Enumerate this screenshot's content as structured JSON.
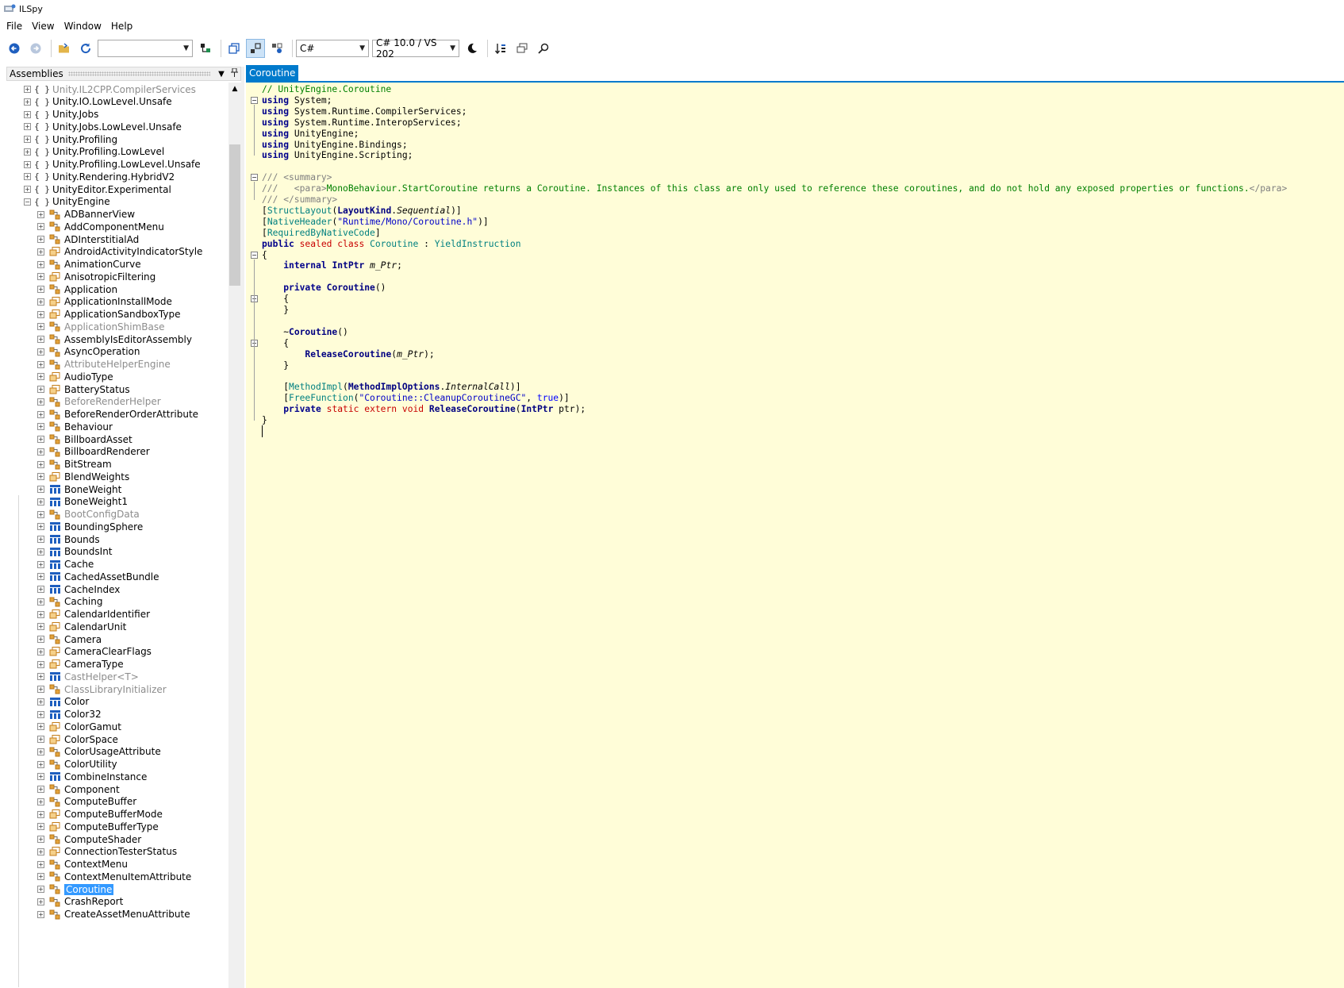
{
  "window": {
    "title": "ILSpy"
  },
  "menu": [
    "File",
    "View",
    "Window",
    "Help"
  ],
  "toolbar": {
    "search_combo": "",
    "language": "C#",
    "language_version": "C# 10.0 / VS 202"
  },
  "left_pane": {
    "header": "Assemblies"
  },
  "tree": [
    {
      "label": "Unity.IL2CPP.CompilerServices",
      "icon": "namespace",
      "level": 0,
      "dim": true
    },
    {
      "label": "Unity.IO.LowLevel.Unsafe",
      "icon": "namespace",
      "level": 0
    },
    {
      "label": "Unity.Jobs",
      "icon": "namespace",
      "level": 0
    },
    {
      "label": "Unity.Jobs.LowLevel.Unsafe",
      "icon": "namespace",
      "level": 0
    },
    {
      "label": "Unity.Profiling",
      "icon": "namespace",
      "level": 0
    },
    {
      "label": "Unity.Profiling.LowLevel",
      "icon": "namespace",
      "level": 0
    },
    {
      "label": "Unity.Profiling.LowLevel.Unsafe",
      "icon": "namespace",
      "level": 0
    },
    {
      "label": "Unity.Rendering.HybridV2",
      "icon": "namespace",
      "level": 0
    },
    {
      "label": "UnityEditor.Experimental",
      "icon": "namespace",
      "level": 0
    },
    {
      "label": "UnityEngine",
      "icon": "namespace",
      "level": 0,
      "expanded": true
    },
    {
      "label": "ADBannerView",
      "icon": "class",
      "level": 1
    },
    {
      "label": "AddComponentMenu",
      "icon": "class",
      "level": 1
    },
    {
      "label": "ADInterstitialAd",
      "icon": "class",
      "level": 1
    },
    {
      "label": "AndroidActivityIndicatorStyle",
      "icon": "enum",
      "level": 1
    },
    {
      "label": "AnimationCurve",
      "icon": "class",
      "level": 1
    },
    {
      "label": "AnisotropicFiltering",
      "icon": "enum",
      "level": 1
    },
    {
      "label": "Application",
      "icon": "class",
      "level": 1
    },
    {
      "label": "ApplicationInstallMode",
      "icon": "enum",
      "level": 1
    },
    {
      "label": "ApplicationSandboxType",
      "icon": "enum",
      "level": 1
    },
    {
      "label": "ApplicationShimBase",
      "icon": "class",
      "level": 1,
      "dim": true
    },
    {
      "label": "AssemblyIsEditorAssembly",
      "icon": "class",
      "level": 1
    },
    {
      "label": "AsyncOperation",
      "icon": "class",
      "level": 1
    },
    {
      "label": "AttributeHelperEngine",
      "icon": "class",
      "level": 1,
      "dim": true
    },
    {
      "label": "AudioType",
      "icon": "enum",
      "level": 1
    },
    {
      "label": "BatteryStatus",
      "icon": "enum",
      "level": 1
    },
    {
      "label": "BeforeRenderHelper",
      "icon": "class-internal",
      "level": 1,
      "dim": true
    },
    {
      "label": "BeforeRenderOrderAttribute",
      "icon": "class",
      "level": 1
    },
    {
      "label": "Behaviour",
      "icon": "class",
      "level": 1
    },
    {
      "label": "BillboardAsset",
      "icon": "class",
      "level": 1
    },
    {
      "label": "BillboardRenderer",
      "icon": "class",
      "level": 1
    },
    {
      "label": "BitStream",
      "icon": "class",
      "level": 1
    },
    {
      "label": "BlendWeights",
      "icon": "enum",
      "level": 1
    },
    {
      "label": "BoneWeight",
      "icon": "struct",
      "level": 1
    },
    {
      "label": "BoneWeight1",
      "icon": "struct",
      "level": 1
    },
    {
      "label": "BootConfigData",
      "icon": "class",
      "level": 1,
      "dim": true
    },
    {
      "label": "BoundingSphere",
      "icon": "struct",
      "level": 1
    },
    {
      "label": "Bounds",
      "icon": "struct",
      "level": 1
    },
    {
      "label": "BoundsInt",
      "icon": "struct",
      "level": 1
    },
    {
      "label": "Cache",
      "icon": "struct",
      "level": 1
    },
    {
      "label": "CachedAssetBundle",
      "icon": "struct",
      "level": 1
    },
    {
      "label": "CacheIndex",
      "icon": "struct",
      "level": 1
    },
    {
      "label": "Caching",
      "icon": "class",
      "level": 1
    },
    {
      "label": "CalendarIdentifier",
      "icon": "enum",
      "level": 1
    },
    {
      "label": "CalendarUnit",
      "icon": "enum",
      "level": 1
    },
    {
      "label": "Camera",
      "icon": "class",
      "level": 1
    },
    {
      "label": "CameraClearFlags",
      "icon": "enum",
      "level": 1
    },
    {
      "label": "CameraType",
      "icon": "enum",
      "level": 1
    },
    {
      "label": "CastHelper<T>",
      "icon": "struct-internal",
      "level": 1,
      "dim": true
    },
    {
      "label": "ClassLibraryInitializer",
      "icon": "class-internal",
      "level": 1,
      "dim": true
    },
    {
      "label": "Color",
      "icon": "struct",
      "level": 1
    },
    {
      "label": "Color32",
      "icon": "struct",
      "level": 1
    },
    {
      "label": "ColorGamut",
      "icon": "enum",
      "level": 1
    },
    {
      "label": "ColorSpace",
      "icon": "enum",
      "level": 1
    },
    {
      "label": "ColorUsageAttribute",
      "icon": "class",
      "level": 1
    },
    {
      "label": "ColorUtility",
      "icon": "class",
      "level": 1
    },
    {
      "label": "CombineInstance",
      "icon": "struct",
      "level": 1
    },
    {
      "label": "Component",
      "icon": "class",
      "level": 1
    },
    {
      "label": "ComputeBuffer",
      "icon": "class",
      "level": 1
    },
    {
      "label": "ComputeBufferMode",
      "icon": "enum",
      "level": 1
    },
    {
      "label": "ComputeBufferType",
      "icon": "enum",
      "level": 1
    },
    {
      "label": "ComputeShader",
      "icon": "class",
      "level": 1
    },
    {
      "label": "ConnectionTesterStatus",
      "icon": "enum",
      "level": 1
    },
    {
      "label": "ContextMenu",
      "icon": "class",
      "level": 1
    },
    {
      "label": "ContextMenuItemAttribute",
      "icon": "class",
      "level": 1
    },
    {
      "label": "Coroutine",
      "icon": "class",
      "level": 1,
      "selected": true
    },
    {
      "label": "CrashReport",
      "icon": "class",
      "level": 1
    },
    {
      "label": "CreateAssetMenuAttribute",
      "icon": "class",
      "level": 1
    }
  ],
  "document": {
    "tab": "Coroutine",
    "code": [
      [
        [
          "c",
          "// UnityEngine.Coroutine"
        ]
      ],
      [
        [
          "k",
          "using"
        ],
        [
          "",
          " System;"
        ]
      ],
      [
        [
          "k",
          "using"
        ],
        [
          "",
          " System.Runtime.CompilerServices;"
        ]
      ],
      [
        [
          "k",
          "using"
        ],
        [
          "",
          " System.Runtime.InteropServices;"
        ]
      ],
      [
        [
          "k",
          "using"
        ],
        [
          "",
          " UnityEngine;"
        ]
      ],
      [
        [
          "k",
          "using"
        ],
        [
          "",
          " UnityEngine.Bindings;"
        ]
      ],
      [
        [
          "k",
          "using"
        ],
        [
          "",
          " UnityEngine.Scripting;"
        ]
      ],
      [],
      [
        [
          "cg",
          "/// <summary>"
        ]
      ],
      [
        [
          "cg",
          "///   <para>"
        ],
        [
          "c",
          "MonoBehaviour.StartCoroutine returns a Coroutine. Instances of this class are only used to reference these coroutines, and do not hold any exposed properties or functions."
        ],
        [
          "cg",
          "</para>"
        ]
      ],
      [
        [
          "cg",
          "/// </summary>"
        ]
      ],
      [
        [
          "",
          "["
        ],
        [
          "t",
          "StructLayout"
        ],
        [
          "",
          "("
        ],
        [
          "m",
          "LayoutKind"
        ],
        [
          "",
          "."
        ],
        [
          "i",
          "Sequential"
        ],
        [
          "",
          ")]"
        ]
      ],
      [
        [
          "",
          "["
        ],
        [
          "t",
          "NativeHeader"
        ],
        [
          "",
          "("
        ],
        [
          "s",
          "\"Runtime/Mono/Coroutine.h\""
        ],
        [
          "",
          ")]"
        ]
      ],
      [
        [
          "",
          "["
        ],
        [
          "t",
          "RequiredByNativeCode"
        ],
        [
          "",
          "]"
        ]
      ],
      [
        [
          "k",
          "public"
        ],
        [
          "",
          " "
        ],
        [
          "kr",
          "sealed"
        ],
        [
          "",
          " "
        ],
        [
          "kr",
          "class"
        ],
        [
          "",
          " "
        ],
        [
          "t",
          "Coroutine"
        ],
        [
          "",
          " : "
        ],
        [
          "t",
          "YieldInstruction"
        ]
      ],
      [
        [
          "",
          "{"
        ]
      ],
      [
        [
          "",
          "    "
        ],
        [
          "k",
          "internal"
        ],
        [
          "",
          " "
        ],
        [
          "m",
          "IntPtr"
        ],
        [
          "",
          " "
        ],
        [
          "i",
          "m_Ptr"
        ],
        [
          "",
          ";"
        ]
      ],
      [],
      [
        [
          "",
          "    "
        ],
        [
          "k",
          "private"
        ],
        [
          "",
          " "
        ],
        [
          "m",
          "Coroutine"
        ],
        [
          "",
          "()"
        ]
      ],
      [
        [
          "",
          "    {"
        ]
      ],
      [
        [
          "",
          "    }"
        ]
      ],
      [],
      [
        [
          "",
          "    ~"
        ],
        [
          "m",
          "Coroutine"
        ],
        [
          "",
          "()"
        ]
      ],
      [
        [
          "",
          "    {"
        ]
      ],
      [
        [
          "",
          "        "
        ],
        [
          "m",
          "ReleaseCoroutine"
        ],
        [
          "",
          "("
        ],
        [
          "i",
          "m_Ptr"
        ],
        [
          "",
          ");"
        ]
      ],
      [
        [
          "",
          "    }"
        ]
      ],
      [],
      [
        [
          "",
          "    ["
        ],
        [
          "t",
          "MethodImpl"
        ],
        [
          "",
          "("
        ],
        [
          "m",
          "MethodImplOptions"
        ],
        [
          "",
          "."
        ],
        [
          "i",
          "InternalCall"
        ],
        [
          "",
          ")]"
        ]
      ],
      [
        [
          "",
          "    ["
        ],
        [
          "t",
          "FreeFunction"
        ],
        [
          "",
          "("
        ],
        [
          "s",
          "\"Coroutine::CleanupCoroutineGC\""
        ],
        [
          "",
          ", "
        ],
        [
          "kb",
          "true"
        ],
        [
          "",
          ")]"
        ]
      ],
      [
        [
          "",
          "    "
        ],
        [
          "k",
          "private"
        ],
        [
          "",
          " "
        ],
        [
          "kr",
          "static"
        ],
        [
          "",
          " "
        ],
        [
          "kr",
          "extern"
        ],
        [
          "",
          " "
        ],
        [
          "kr",
          "void"
        ],
        [
          "",
          " "
        ],
        [
          "m",
          "ReleaseCoroutine"
        ],
        [
          "",
          "("
        ],
        [
          "m",
          "IntPtr"
        ],
        [
          "",
          " ptr);"
        ]
      ],
      [
        [
          "",
          "}"
        ]
      ]
    ]
  },
  "colors": {
    "accent": "#007acc",
    "selection": "#3399ff",
    "code_background": "#fffdd8"
  }
}
